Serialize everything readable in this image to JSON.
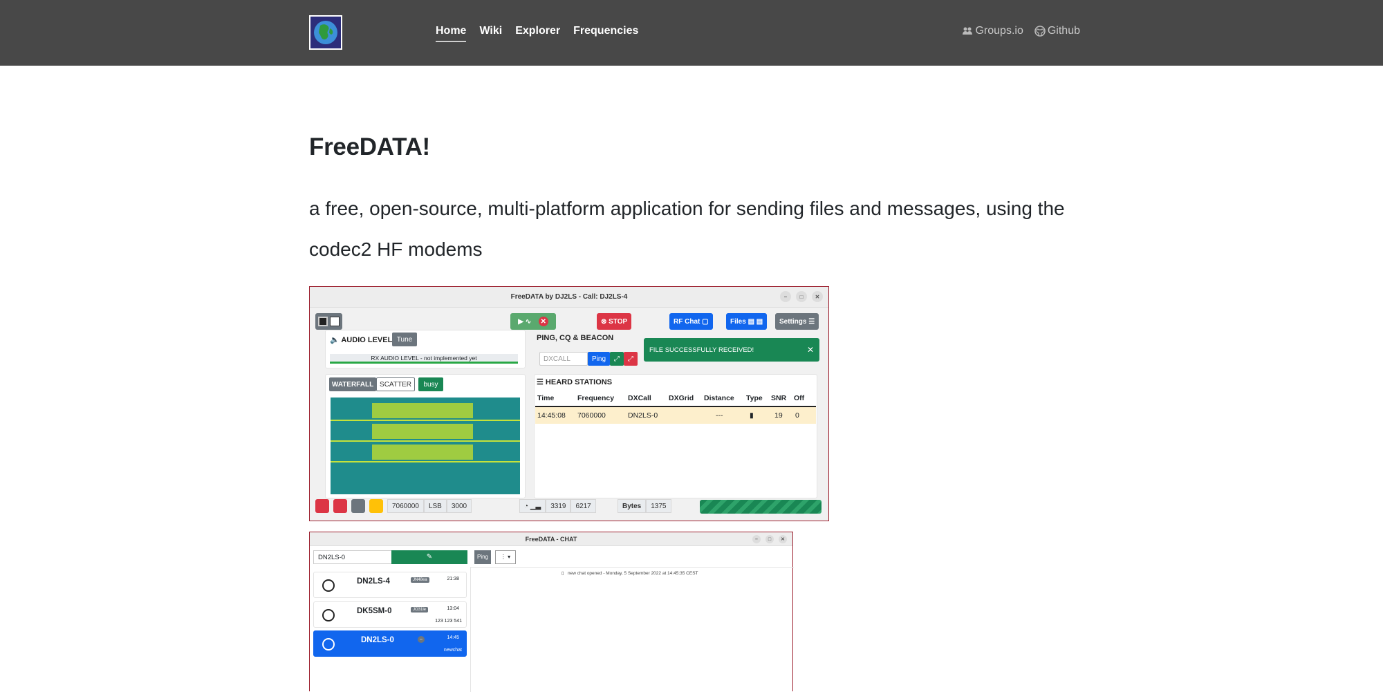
{
  "nav": {
    "items": [
      "Home",
      "Wiki",
      "Explorer",
      "Frequencies"
    ],
    "active": "Home",
    "right": [
      {
        "label": "Groups.io",
        "icon": "users-icon"
      },
      {
        "label": "Github",
        "icon": "github-icon"
      }
    ]
  },
  "hero": {
    "title": "FreeDATA!",
    "lead": "a free, open-source, multi-platform application for sending files and messages, using the codec2 HF modems"
  },
  "shot1": {
    "window_title": "FreeDATA by DJ2LS - Call: DJ2LS-4",
    "toolbar": {
      "stop": "STOP",
      "rf_chat": "RF Chat",
      "files": "Files",
      "settings": "Settings"
    },
    "audio": {
      "title": "AUDIO LEVEL",
      "tune": "Tune",
      "rx_text": "RX AUDIO LEVEL - not implemented yet"
    },
    "waterfall": {
      "tab_waterfall": "WATERFALL",
      "tab_scatter": "SCATTER",
      "busy": "busy"
    },
    "ping": {
      "title": "PING, CQ & BEACON",
      "placeholder": "DXCALL",
      "ping": "Ping"
    },
    "toast": "FILE SUCCESSFULLY RECEIVED!",
    "heard": {
      "title": "HEARD STATIONS",
      "columns": [
        "Time",
        "Frequency",
        "DXCall",
        "DXGrid",
        "Distance",
        "Type",
        "SNR",
        "Off"
      ],
      "rows": [
        [
          "14:45:08",
          "7060000",
          "DN2LS-0",
          "",
          "---",
          "",
          "19",
          "0"
        ]
      ]
    },
    "status": {
      "freq": "7060000",
      "mode": "LSB",
      "bw": "3000",
      "v1": "3319",
      "v2": "6217",
      "bytes_label": "Bytes",
      "bytes": "1375"
    }
  },
  "shot2": {
    "window_title": "FreeDATA - CHAT",
    "search_value": "DN2LS-0",
    "ping": "Ping",
    "opened": "new chat opened - Monday, 5 September 2022 at 14:45:35 CEST",
    "contacts": [
      {
        "name": "DN2LS-4",
        "grid": "JN48ea",
        "time": "21:38",
        "sub": ""
      },
      {
        "name": "DK5SM-0",
        "grid": "JO31le",
        "time": "13:04",
        "sub": "123 123 541"
      },
      {
        "name": "DN2LS-0",
        "grid": "",
        "time": "14:45",
        "sub": "newchat"
      }
    ]
  }
}
